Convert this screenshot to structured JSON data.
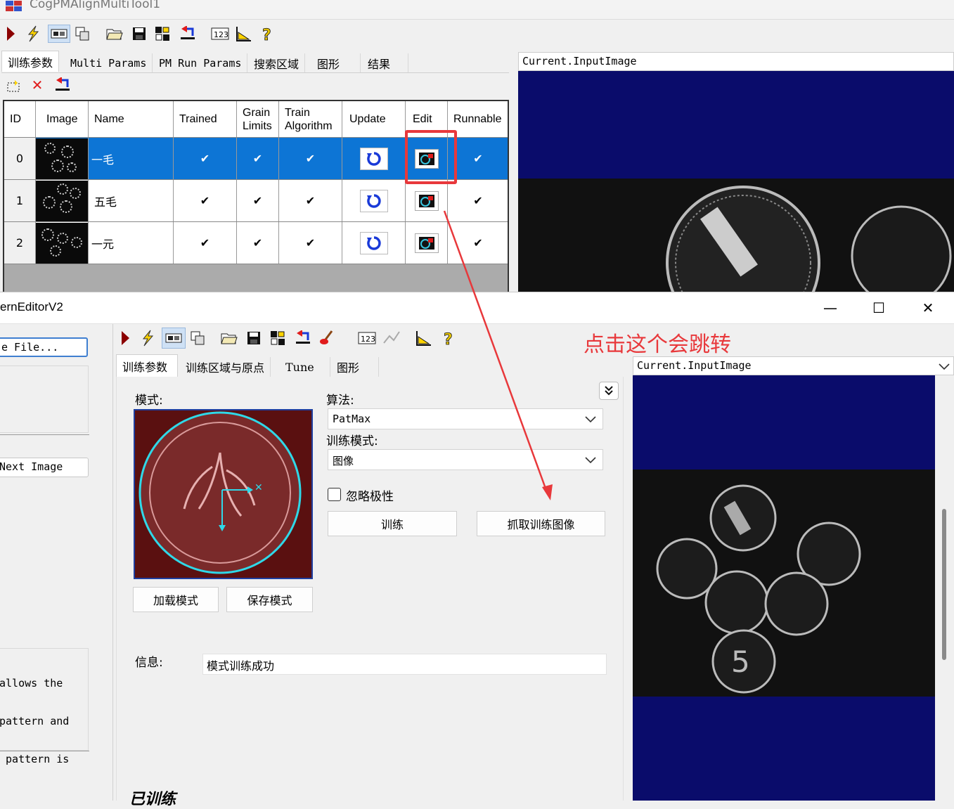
{
  "top_window": {
    "title": "CogPMAlignMultiTool1",
    "tabs": [
      "训练参数",
      "Multi Params",
      "PM Run Params",
      "搜索区域",
      "图形",
      "结果"
    ],
    "grid": {
      "headers": [
        "ID",
        "Image",
        "Name",
        "Trained",
        "Grain Limits",
        "Train Algorithm",
        "Update",
        "Edit",
        "Runnable"
      ],
      "rows": [
        {
          "id": "0",
          "name": "一毛",
          "trained": "✔",
          "grain": "✔",
          "train_alg": "✔",
          "runnable": "✔",
          "selected": true
        },
        {
          "id": "1",
          "name": "五毛",
          "trained": "✔",
          "grain": "✔",
          "train_alg": "✔",
          "runnable": "✔",
          "selected": false
        },
        {
          "id": "2",
          "name": "一元",
          "trained": "✔",
          "grain": "✔",
          "train_alg": "✔",
          "runnable": "✔",
          "selected": false
        }
      ]
    },
    "image_panel_title": "Current.InputImage"
  },
  "bottom_window": {
    "title": "ernEditorV2",
    "side": {
      "file_button": "e File...",
      "next_image_button": "Next Image",
      "desc_lines": [
        "allows the",
        "pattern and",
        " pattern is"
      ]
    },
    "tabs": [
      "训练参数",
      "训练区域与原点",
      "Tune",
      "图形"
    ],
    "labels": {
      "pattern": "模式:",
      "algorithm": "算法:",
      "train_mode": "训练模式:",
      "ignore_polarity": "忽略极性",
      "info": "信息:",
      "trained_status": "已训练"
    },
    "algorithm_value": "PatMax",
    "train_mode_value": "图像",
    "buttons": {
      "train": "训练",
      "grab_train_image": "抓取训练图像",
      "load_pattern": "加载模式",
      "save_pattern": "保存模式"
    },
    "info_value": "模式训练成功",
    "image_panel_title": "Current.InputImage",
    "window_controls": {
      "minimize": "—",
      "maximize": "☐",
      "close": "✕"
    }
  },
  "annotation": {
    "text": "点击这个会跳转",
    "color": "#e8383b"
  }
}
